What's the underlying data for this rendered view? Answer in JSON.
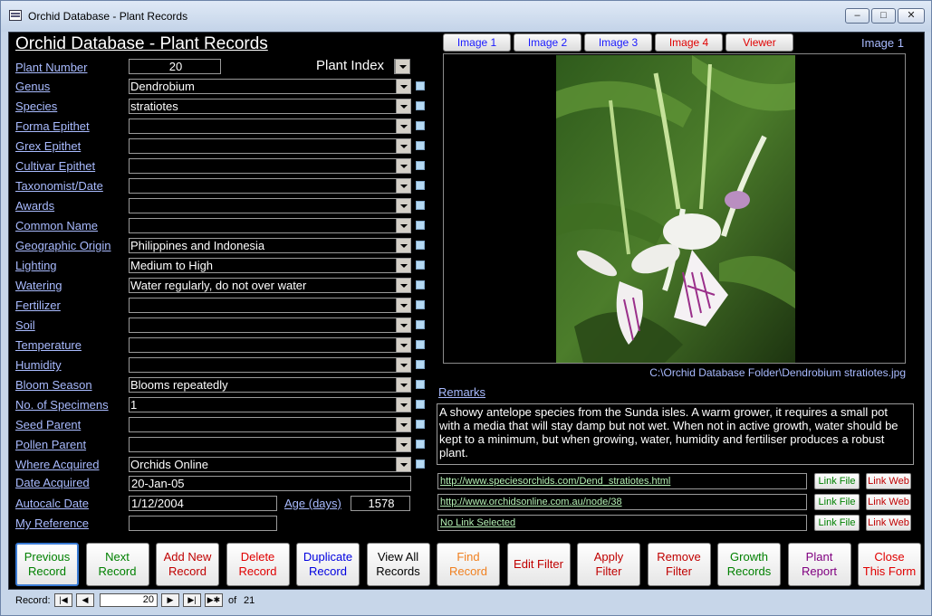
{
  "window": {
    "title": "Orchid Database - Plant Records",
    "min": "‒",
    "max": "□",
    "close": "✕"
  },
  "form": {
    "title": "Orchid Database - Plant Records",
    "plant_number_label": "Plant Number",
    "plant_number_value": "20",
    "plant_index_label": "Plant Index",
    "fields": [
      {
        "label": "Genus",
        "value": "Dendrobium"
      },
      {
        "label": "Species",
        "value": "stratiotes"
      },
      {
        "label": "Forma Epithet",
        "value": ""
      },
      {
        "label": "Grex Epithet",
        "value": ""
      },
      {
        "label": "Cultivar Epithet",
        "value": ""
      },
      {
        "label": "Taxonomist/Date",
        "value": ""
      },
      {
        "label": "Awards",
        "value": ""
      },
      {
        "label": "Common Name",
        "value": ""
      },
      {
        "label": "Geographic Origin",
        "value": "Philippines and Indonesia"
      },
      {
        "label": "Lighting",
        "value": "Medium to High"
      },
      {
        "label": "Watering",
        "value": "Water regularly, do not over water"
      },
      {
        "label": "Fertilizer",
        "value": ""
      },
      {
        "label": "Soil",
        "value": ""
      },
      {
        "label": "Temperature",
        "value": ""
      },
      {
        "label": "Humidity",
        "value": ""
      },
      {
        "label": "Bloom Season",
        "value": "Blooms repeatedly"
      },
      {
        "label": "No. of Specimens",
        "value": "1"
      },
      {
        "label": "Seed Parent",
        "value": ""
      },
      {
        "label": "Pollen Parent",
        "value": ""
      },
      {
        "label": "Where Acquired",
        "value": "Orchids Online"
      }
    ],
    "date_acquired_label": "Date Acquired",
    "date_acquired_value": "20-Jan-05",
    "autocalc_label": "Autocalc Date",
    "autocalc_value": "1/12/2004",
    "age_label": "Age (days)",
    "age_value": "1578",
    "my_reference_label": "My Reference",
    "my_reference_value": ""
  },
  "images": {
    "tabs": [
      "Image 1",
      "Image 2",
      "Image 3",
      "Image 4",
      "Viewer"
    ],
    "tab_colors": [
      "#1a1aff",
      "#1a1aff",
      "#1a1aff",
      "#e00000",
      "#e00000"
    ],
    "current_label": "Image 1",
    "path": "C:\\Orchid Database Folder\\Dendrobium stratiotes.jpg"
  },
  "remarks": {
    "label": "Remarks",
    "text": "A showy antelope species from the Sunda isles. A warm grower, it requires a small pot with a media that will stay damp but not wet. When not in active growth, water should be kept to a minimum, but when growing, water, humidity and fertiliser produces a robust plant."
  },
  "links": [
    {
      "url": "http://www.speciesorchids.com/Dend_stratiotes.html",
      "file": "Link File",
      "web": "Link Web"
    },
    {
      "url": "http://www.orchidsonline.com.au/node/38",
      "file": "Link File",
      "web": "Link Web"
    },
    {
      "url": "No Link Selected",
      "file": "Link File",
      "web": "Link Web"
    }
  ],
  "nav_buttons": [
    {
      "line1": "Previous",
      "line2": "Record",
      "color": "#008000"
    },
    {
      "line1": "Next",
      "line2": "Record",
      "color": "#008000"
    },
    {
      "line1": "Add New",
      "line2": "Record",
      "color": "#c00000"
    },
    {
      "line1": "Delete",
      "line2": "Record",
      "color": "#e00000"
    },
    {
      "line1": "Duplicate",
      "line2": "Record",
      "color": "#0000e0"
    },
    {
      "line1": "View All",
      "line2": "Records",
      "color": "#000000"
    },
    {
      "line1": "Find",
      "line2": "Record",
      "color": "#f08020"
    },
    {
      "line1": "Edit Filter",
      "line2": "",
      "color": "#c00000"
    },
    {
      "line1": "Apply",
      "line2": "Filter",
      "color": "#c00000"
    },
    {
      "line1": "Remove",
      "line2": "Filter",
      "color": "#c00000"
    },
    {
      "line1": "Growth",
      "line2": "Records",
      "color": "#008000"
    },
    {
      "line1": "Plant",
      "line2": "Report",
      "color": "#800080"
    },
    {
      "line1": "Close",
      "line2": "This Form",
      "color": "#e00000"
    }
  ],
  "record_nav": {
    "label": "Record:",
    "current": "20",
    "of": "of",
    "total": "21"
  }
}
